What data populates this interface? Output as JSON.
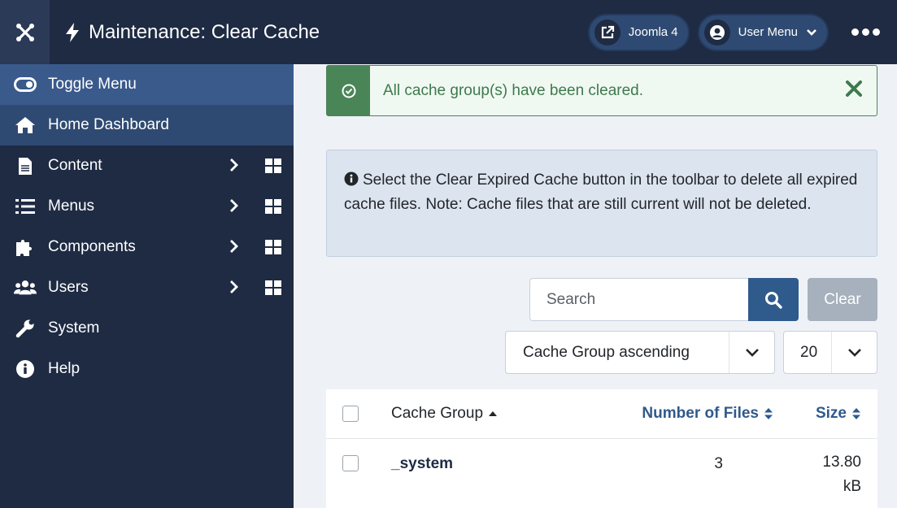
{
  "header": {
    "title": "Maintenance: Clear Cache",
    "site_link_label": "Joomla 4",
    "user_menu_label": "User Menu"
  },
  "sidebar": {
    "items": [
      {
        "label": "Toggle Menu",
        "icon": "toggle-icon"
      },
      {
        "label": "Home Dashboard",
        "icon": "home-icon"
      },
      {
        "label": "Content",
        "icon": "file-icon"
      },
      {
        "label": "Menus",
        "icon": "list-icon"
      },
      {
        "label": "Components",
        "icon": "puzzle-icon"
      },
      {
        "label": "Users",
        "icon": "users-icon"
      },
      {
        "label": "System",
        "icon": "wrench-icon"
      },
      {
        "label": "Help",
        "icon": "info-icon"
      }
    ]
  },
  "alerts": {
    "success": "All cache group(s) have been cleared.",
    "info": "Select the Clear Expired Cache button in the toolbar to delete all expired cache files. Note: Cache files that are still current will not be deleted."
  },
  "filters": {
    "search_placeholder": "Search",
    "clear_label": "Clear",
    "ordering_value": "Cache Group ascending",
    "limit_value": "20"
  },
  "table": {
    "headers": {
      "group": "Cache Group",
      "files": "Number of Files",
      "size": "Size"
    },
    "rows": [
      {
        "group": "_system",
        "files": "3",
        "size_value": "13.80",
        "size_unit": "kB"
      }
    ]
  },
  "colors": {
    "header_bg": "#1e2b43",
    "sidebar_active": "#2f4a72",
    "success": "#4a8557",
    "primary": "#2f5a8c"
  }
}
